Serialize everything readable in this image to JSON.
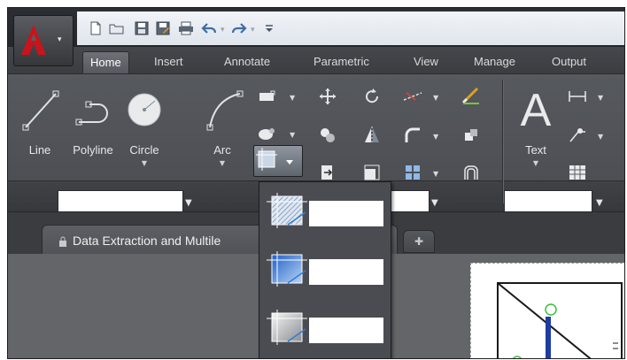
{
  "quick_access": {
    "icons": [
      "new-icon",
      "open-icon",
      "save-icon",
      "save-as-icon",
      "plot-icon",
      "undo-icon",
      "redo-icon",
      "customize-icon"
    ]
  },
  "tabs": [
    {
      "label": "Home",
      "active": true
    },
    {
      "label": "Insert",
      "active": false
    },
    {
      "label": "Annotate",
      "active": false
    },
    {
      "label": "Parametric",
      "active": false
    },
    {
      "label": "View",
      "active": false
    },
    {
      "label": "Manage",
      "active": false
    },
    {
      "label": "Output",
      "active": false
    }
  ],
  "ribbon": {
    "draw_tools": [
      {
        "label": "Line",
        "icon": "line-icon"
      },
      {
        "label": "Polyline",
        "icon": "polyline-icon"
      },
      {
        "label": "Circle",
        "icon": "circle-icon"
      },
      {
        "label": "Arc",
        "icon": "arc-icon"
      }
    ],
    "annotation_tool": {
      "label": "Text",
      "icon": "text-icon"
    }
  },
  "document_tab": {
    "label": "Data Extraction and Multile"
  },
  "colors": {
    "app_red": "#c8141c",
    "ribbon_bg": "#4f5156",
    "accent_blue": "#2f7cd8"
  }
}
